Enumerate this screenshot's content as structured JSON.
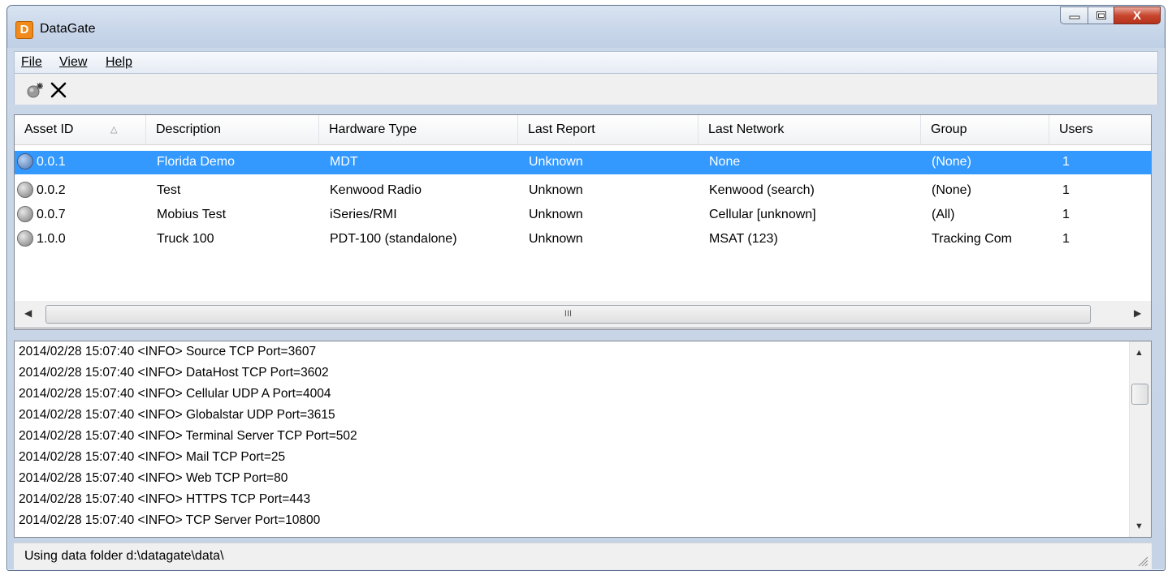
{
  "window": {
    "title": "DataGate",
    "app_icon_letter": "D",
    "close_glyph": "X"
  },
  "menu": [
    {
      "label": "File"
    },
    {
      "label": "View"
    },
    {
      "label": "Help"
    }
  ],
  "toolbar": {
    "new_icon": "new-asset-icon",
    "delete_icon": "delete-icon"
  },
  "list": {
    "columns": [
      "Asset ID",
      "Description",
      "Hardware Type",
      "Last Report",
      "Last Network",
      "Group",
      "Users"
    ],
    "sort_column": "Asset ID",
    "rows": [
      {
        "id": "0.0.1",
        "description": "Florida Demo",
        "hardware": "MDT",
        "last_report": "Unknown",
        "last_network": "None",
        "group": "(None)",
        "users": "1",
        "selected": true
      },
      {
        "id": "0.0.2",
        "description": "Test",
        "hardware": "Kenwood Radio",
        "last_report": "Unknown",
        "last_network": "Kenwood (search)",
        "group": "(None)",
        "users": "1",
        "selected": false
      },
      {
        "id": "0.0.7",
        "description": "Mobius Test",
        "hardware": "iSeries/RMI",
        "last_report": "Unknown",
        "last_network": "Cellular [unknown]",
        "group": "(All)",
        "users": "1",
        "selected": false
      },
      {
        "id": "1.0.0",
        "description": "Truck 100",
        "hardware": "PDT-100 (standalone)",
        "last_report": "Unknown",
        "last_network": "MSAT (123)",
        "group": "Tracking Com",
        "users": "1",
        "selected": false
      }
    ]
  },
  "hscroll": {
    "thumb_grip": "III"
  },
  "log": [
    "2014/02/28 15:07:40 <INFO> Source TCP Port=3607",
    "2014/02/28 15:07:40 <INFO> DataHost TCP Port=3602",
    "2014/02/28 15:07:40 <INFO> Cellular UDP A Port=4004",
    "2014/02/28 15:07:40 <INFO> Globalstar UDP Port=3615",
    "2014/02/28 15:07:40 <INFO> Terminal Server TCP Port=502",
    "2014/02/28 15:07:40 <INFO> Mail TCP Port=25",
    "2014/02/28 15:07:40 <INFO> Web TCP Port=80",
    "2014/02/28 15:07:40 <INFO> HTTPS TCP Port=443",
    "2014/02/28 15:07:40 <INFO> TCP Server Port=10800"
  ],
  "status": {
    "text": "Using data folder d:\\datagate\\data\\"
  },
  "colors": {
    "selection": "#3399ff",
    "window_frame": "#c4d3e6",
    "close_button": "#c9472f"
  }
}
